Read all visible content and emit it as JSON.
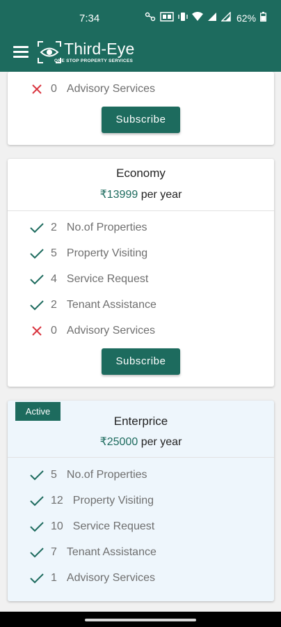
{
  "status_bar": {
    "time": "7:34",
    "battery": "62%"
  },
  "app": {
    "brand": "Third-Eye",
    "tagline": "ONE STOP PROPERTY SERVICES"
  },
  "colors": {
    "primary": "#1d6b5e",
    "check": "#1d6b5e",
    "cross": "#d9343f",
    "active_bg": "#eef6fc"
  },
  "plans": [
    {
      "features": [
        {
          "icon": "cross-icon",
          "count": "0",
          "label": "Advisory Services"
        }
      ],
      "button": "Subscribe"
    },
    {
      "name": "Economy",
      "price": "₹13999",
      "period": "per year",
      "features": [
        {
          "icon": "check-icon",
          "count": "2",
          "label": "No.of Properties"
        },
        {
          "icon": "check-icon",
          "count": "5",
          "label": "Property Visiting"
        },
        {
          "icon": "check-icon",
          "count": "4",
          "label": "Service Request"
        },
        {
          "icon": "check-icon",
          "count": "2",
          "label": "Tenant Assistance"
        },
        {
          "icon": "cross-icon",
          "count": "0",
          "label": "Advisory Services"
        }
      ],
      "button": "Subscribe"
    },
    {
      "badge": "Active",
      "name": "Enterprice",
      "price": "₹25000",
      "period": "per year",
      "features": [
        {
          "icon": "check-icon",
          "count": "5",
          "label": "No.of Properties"
        },
        {
          "icon": "check-icon",
          "count": "12",
          "label": "Property Visiting"
        },
        {
          "icon": "check-icon",
          "count": "10",
          "label": "Service Request"
        },
        {
          "icon": "check-icon",
          "count": "7",
          "label": "Tenant Assistance"
        },
        {
          "icon": "check-icon",
          "count": "1",
          "label": "Advisory Services"
        }
      ]
    }
  ]
}
